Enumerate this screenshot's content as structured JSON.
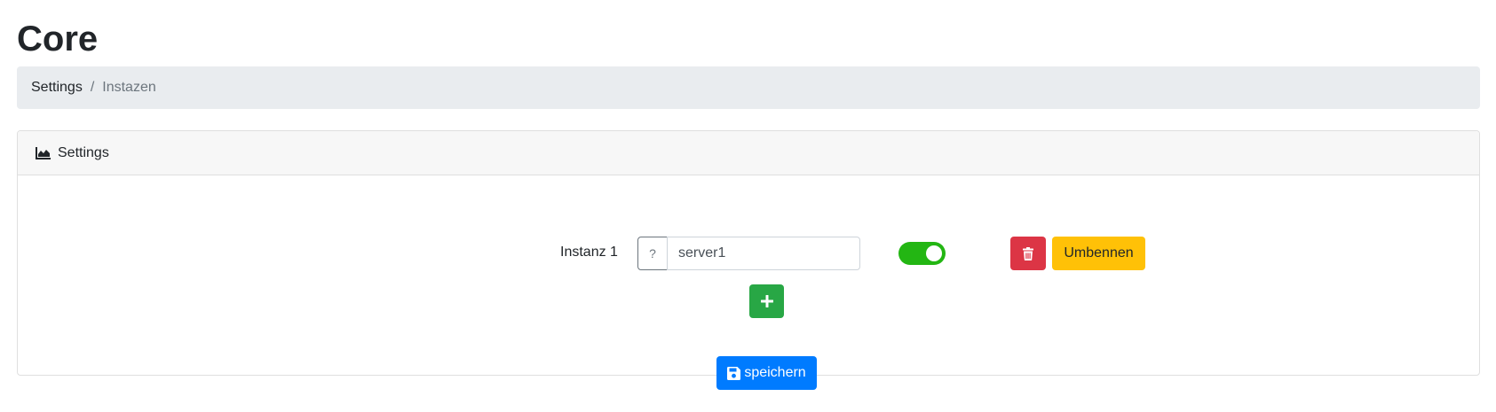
{
  "page": {
    "title": "Core"
  },
  "breadcrumb": {
    "items": [
      {
        "label": "Settings"
      },
      {
        "label": "Instazen"
      }
    ],
    "separator": "/"
  },
  "card": {
    "header_icon": "area-chart-icon",
    "header_title": "Settings",
    "instances": [
      {
        "label": "Instanz 1",
        "help_label": "?",
        "value": "server1",
        "enabled": true,
        "delete_icon": "trash-icon",
        "rename_label": "Umbennen"
      }
    ],
    "add_icon": "plus-icon",
    "save_icon": "floppy-disk-icon",
    "save_label": "speichern"
  },
  "colors": {
    "breadcrumb_bg": "#e9ecef",
    "toggle_on": "#23b613",
    "delete": "#dc3545",
    "rename": "#ffc107",
    "add": "#28a745",
    "save": "#007bff"
  }
}
